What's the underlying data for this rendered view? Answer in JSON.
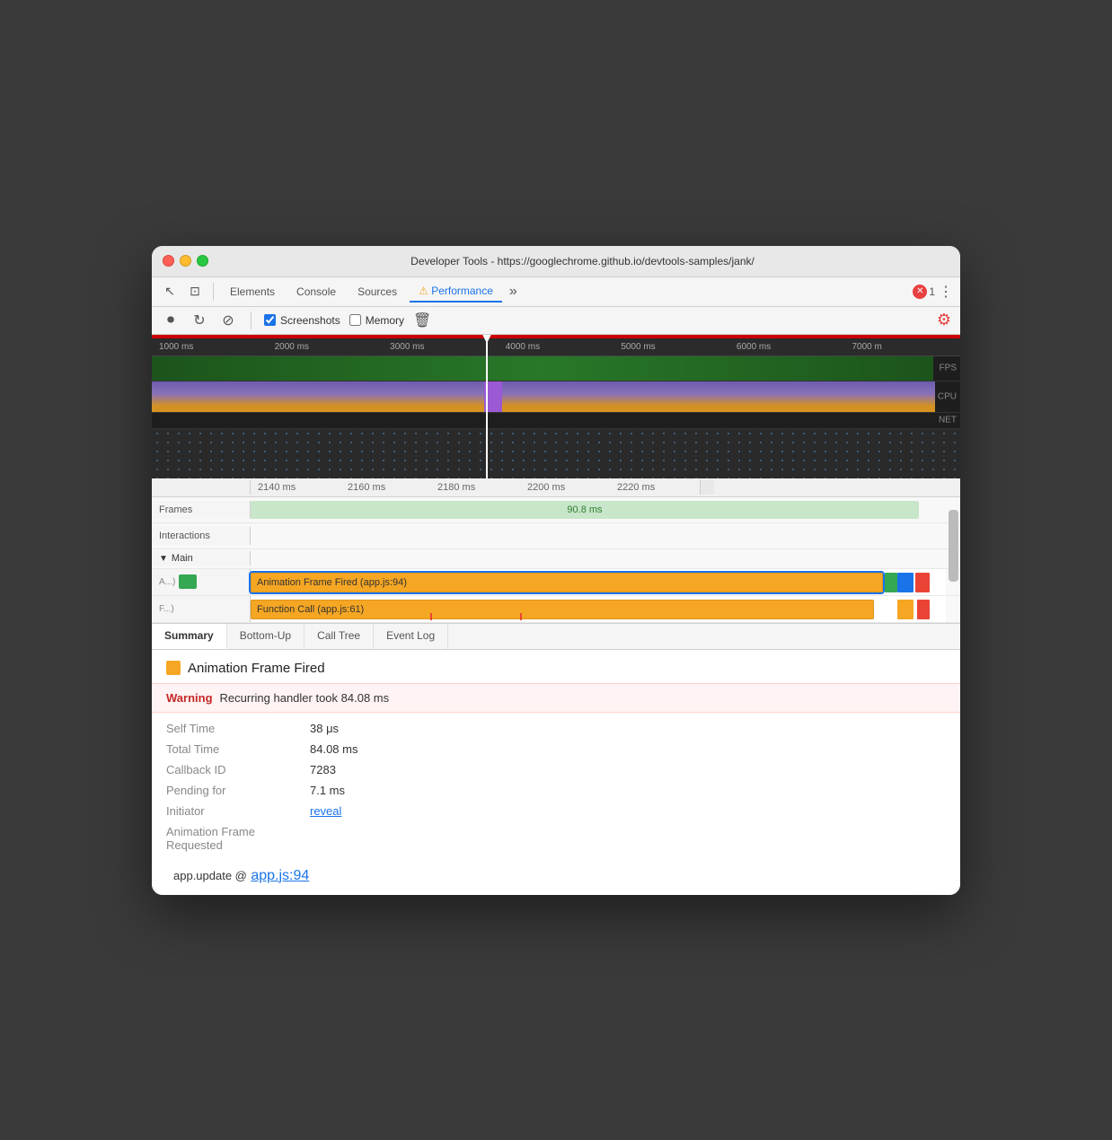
{
  "window": {
    "title": "Developer Tools - https://googlechrome.github.io/devtools-samples/jank/"
  },
  "toolbar": {
    "tabs": [
      {
        "id": "elements",
        "label": "Elements",
        "active": false
      },
      {
        "id": "console",
        "label": "Console",
        "active": false
      },
      {
        "id": "sources",
        "label": "Sources",
        "active": false
      },
      {
        "id": "performance",
        "label": "Performance",
        "active": true,
        "warning": true
      },
      {
        "id": "more",
        "label": "»",
        "active": false
      }
    ],
    "close_count": "1"
  },
  "toolbar2": {
    "screenshots_label": "Screenshots",
    "memory_label": "Memory"
  },
  "overview": {
    "time_marks": [
      "1000 ms",
      "2000 ms",
      "3000 ms",
      "4000 ms",
      "5000 ms",
      "6000 ms",
      "7000 m"
    ],
    "fps_label": "FPS",
    "cpu_label": "CPU",
    "net_label": "NET"
  },
  "detail": {
    "time_marks": [
      "2140 ms",
      "2160 ms",
      "2180 ms",
      "2200 ms",
      "2220 ms"
    ],
    "frames_label": "Frames",
    "frames_duration": "90.8 ms",
    "interactions_label": "Interactions",
    "main_label": "▼ Main",
    "flame1_prefix": "A...)",
    "flame1_text": "Animation Frame Fired (app.js:94)",
    "flame2_prefix": "F...)",
    "flame2_text": "Function Call (app.js:61)"
  },
  "bottom_tabs": [
    {
      "id": "summary",
      "label": "Summary",
      "active": true
    },
    {
      "id": "bottom-up",
      "label": "Bottom-Up",
      "active": false
    },
    {
      "id": "call-tree",
      "label": "Call Tree",
      "active": false
    },
    {
      "id": "event-log",
      "label": "Event Log",
      "active": false
    }
  ],
  "summary": {
    "title": "Animation Frame Fired",
    "warning_label": "Warning",
    "warning_text": "Recurring handler took 84.08 ms",
    "fields": [
      {
        "key": "Self Time",
        "value": "38 μs",
        "type": "text"
      },
      {
        "key": "Total Time",
        "value": "84.08 ms",
        "type": "text"
      },
      {
        "key": "Callback ID",
        "value": "7283",
        "type": "text"
      },
      {
        "key": "Pending for",
        "value": "7.1 ms",
        "type": "text"
      },
      {
        "key": "Initiator",
        "value": "reveal",
        "type": "link"
      },
      {
        "key": "Animation Frame Requested",
        "value": "",
        "type": "text"
      }
    ],
    "stack_prefix": "app.update @",
    "stack_link": "app.js:94"
  }
}
